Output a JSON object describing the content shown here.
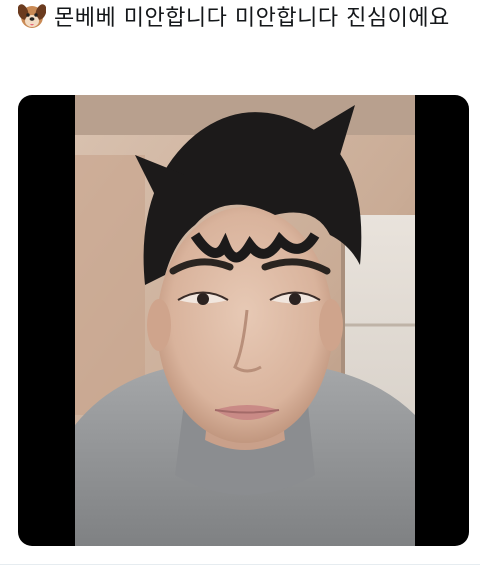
{
  "tweet": {
    "emoji_icon": "dog-face-icon",
    "text": "몬베베 미안합니다 미안합니다 진심이에요"
  },
  "media": {
    "type": "video-still",
    "description_icon": "portrait-photo"
  }
}
